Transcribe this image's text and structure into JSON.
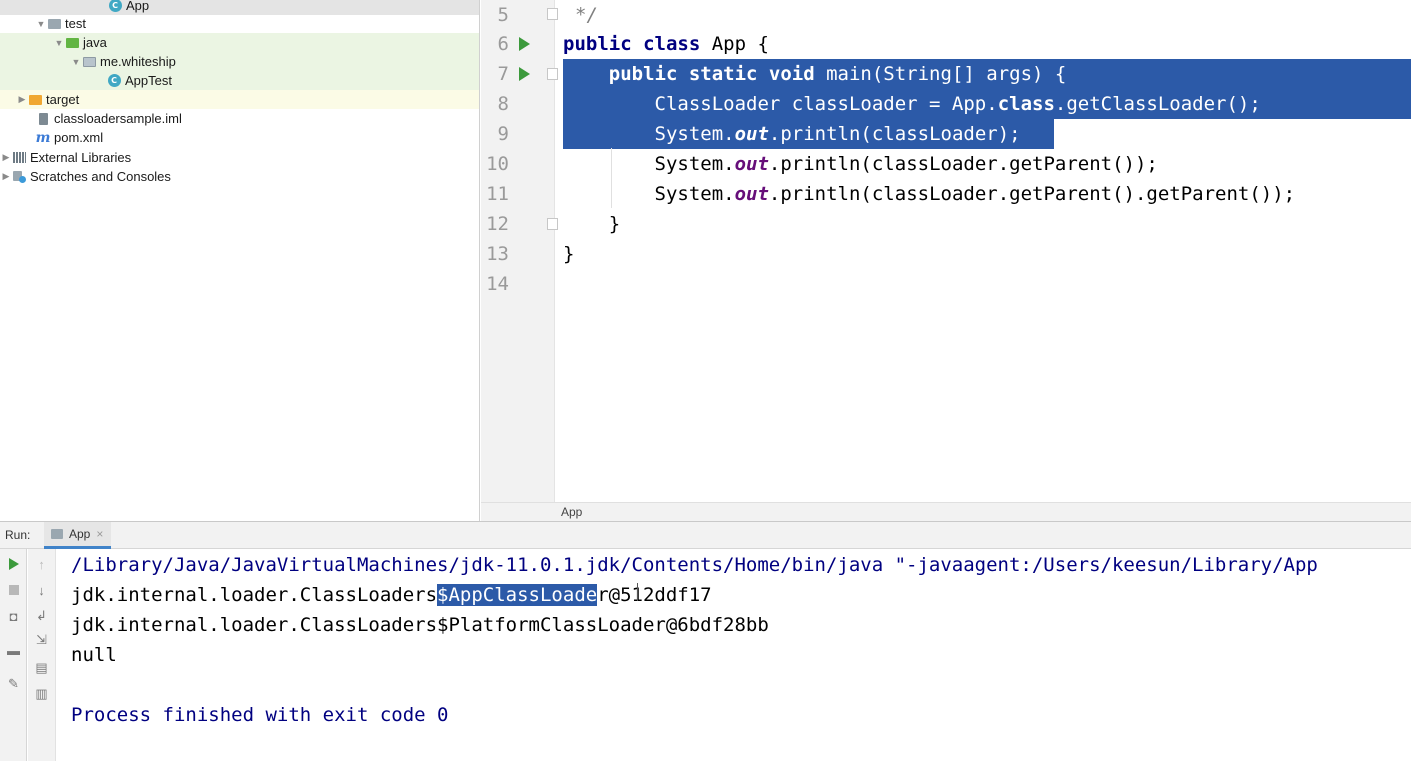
{
  "project_tree": {
    "items": [
      {
        "label": "App",
        "icon": "java-class-icon"
      },
      {
        "label": "test",
        "icon": "folder-icon"
      },
      {
        "label": "java",
        "icon": "test-source-folder-icon"
      },
      {
        "label": "me.whiteship",
        "icon": "package-icon"
      },
      {
        "label": "AppTest",
        "icon": "java-class-icon"
      },
      {
        "label": "target",
        "icon": "excluded-folder-icon"
      },
      {
        "label": "classloadersample.iml",
        "icon": "iml-file-icon"
      },
      {
        "label": "pom.xml",
        "icon": "maven-icon"
      },
      {
        "label": "External Libraries",
        "icon": "libraries-icon"
      },
      {
        "label": "Scratches and Consoles",
        "icon": "scratches-icon"
      }
    ]
  },
  "editor": {
    "line_numbers": [
      "5",
      "6",
      "7",
      "8",
      "9",
      "10",
      "11",
      "12",
      "13",
      "14"
    ],
    "breadcrumb": "App",
    "code": {
      "l5": "*/",
      "l6_kw": "public class",
      "l6_rest": " App {",
      "l7_indent": "    ",
      "l7_kw": "public static void",
      "l7_rest": " main(String[] args) {",
      "l8_a": "        ClassLoader classLoader = App.",
      "l8_kw": "class",
      "l8_b": ".getClassLoader();",
      "l9_a": "        System.",
      "l9_st": "out",
      "l9_b": ".println(classLoader);",
      "l10_a": "        System.",
      "l10_st": "out",
      "l10_b": ".println(classLoader.getParent());",
      "l11_a": "        System.",
      "l11_st": "out",
      "l11_b": ".println(classLoader.getParent().getParent());",
      "l12": "    }",
      "l13": "}"
    }
  },
  "run_panel": {
    "label": "Run:",
    "tab_label": "App",
    "tab_close": "×",
    "console": {
      "line1": "/Library/Java/JavaVirtualMachines/jdk-11.0.1.jdk/Contents/Home/bin/java \"-javaagent:/Users/keesun/Library/App",
      "line2_a": "jdk.internal.loader.ClassLoaders",
      "line2_sel": "$AppClassLoade",
      "line2_b": "r@512ddf17",
      "line3": "jdk.internal.loader.ClassLoaders$PlatformClassLoader@6bdf28bb",
      "line4": "null",
      "line6": "Process finished with exit code 0"
    }
  }
}
